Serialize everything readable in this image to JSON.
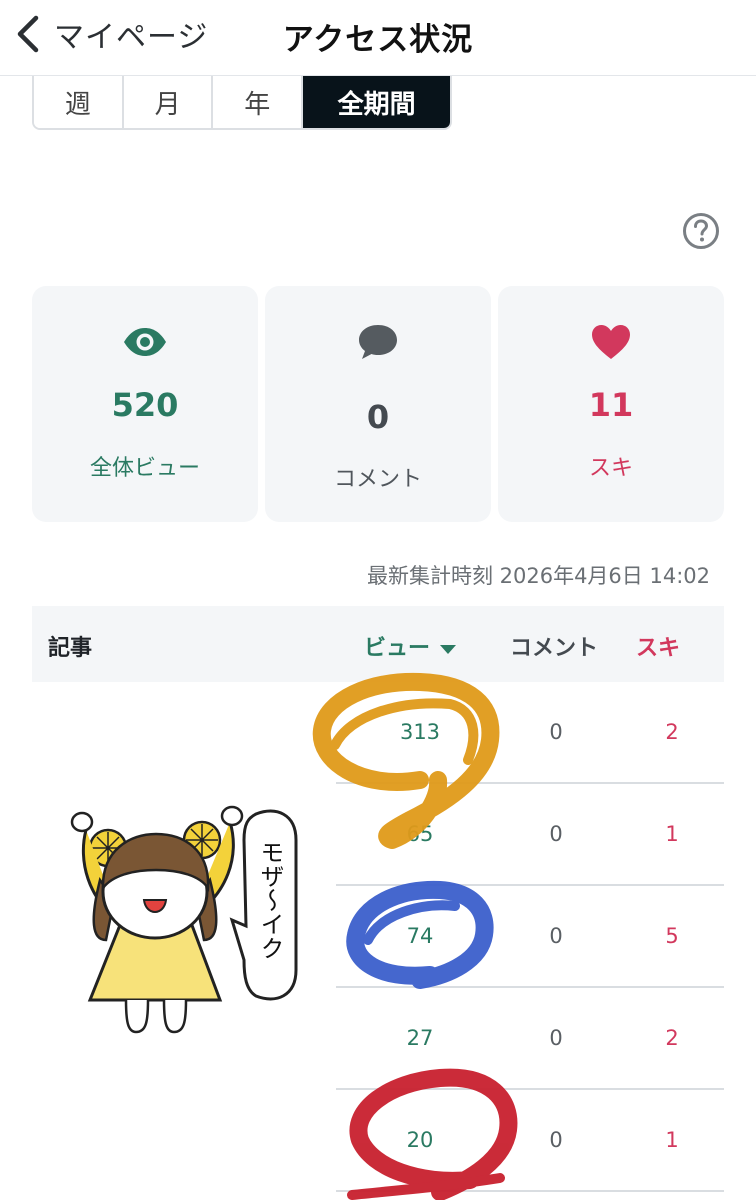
{
  "header": {
    "back_label": "マイページ",
    "title": "アクセス状況"
  },
  "period_tabs": [
    {
      "label": "週",
      "active": false
    },
    {
      "label": "月",
      "active": false
    },
    {
      "label": "年",
      "active": false
    },
    {
      "label": "全期間",
      "active": true
    }
  ],
  "stats": {
    "views": {
      "icon": "eye-icon",
      "value": "520",
      "label": "全体ビュー",
      "color": "#2a7a62"
    },
    "comments": {
      "icon": "speech-bubble-icon",
      "value": "0",
      "label": "コメント",
      "color": "#444a50"
    },
    "likes": {
      "icon": "heart-icon",
      "value": "11",
      "label": "スキ",
      "color": "#d2385d"
    }
  },
  "updated": "最新集計時刻 2026年4月6日 14:02",
  "table": {
    "headers": {
      "article": "記事",
      "views": "ビュー",
      "comments": "コメント",
      "likes": "スキ"
    },
    "rows": [
      {
        "views": "313",
        "comments": "0",
        "likes": "2"
      },
      {
        "views": "65",
        "comments": "0",
        "likes": "1"
      },
      {
        "views": "74",
        "comments": "0",
        "likes": "5"
      },
      {
        "views": "27",
        "comments": "0",
        "likes": "2"
      },
      {
        "views": "20",
        "comments": "0",
        "likes": "1"
      }
    ]
  },
  "illustration": {
    "speech_text": "モザ〜イク"
  },
  "colors": {
    "scribble_orange": "#e09a1a",
    "scribble_blue": "#3c5fcc",
    "scribble_red": "#c8202e"
  }
}
